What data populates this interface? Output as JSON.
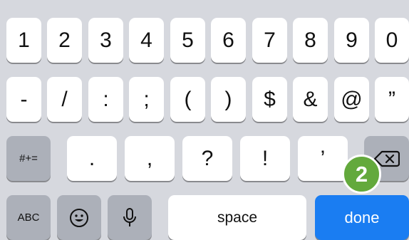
{
  "keyboard": {
    "row1": [
      "1",
      "2",
      "3",
      "4",
      "5",
      "6",
      "7",
      "8",
      "9",
      "0"
    ],
    "row2": [
      "-",
      "/",
      ":",
      ";",
      "(",
      ")",
      "$",
      "&",
      "@",
      "”"
    ],
    "row3": {
      "mode_key": "#+=",
      "keys": [
        ".",
        ",",
        "?",
        "!",
        "’"
      ],
      "backspace_icon": "backspace-icon"
    },
    "row4": {
      "abc": "ABC",
      "emoji_icon": "emoji-icon",
      "mic_icon": "microphone-icon",
      "space": "space",
      "done": "done"
    },
    "badge": "2"
  },
  "colors": {
    "background": "#d6d8de",
    "key": "#ffffff",
    "function_key": "#acb0b9",
    "done": "#1a7df2",
    "badge": "#63a93c"
  }
}
